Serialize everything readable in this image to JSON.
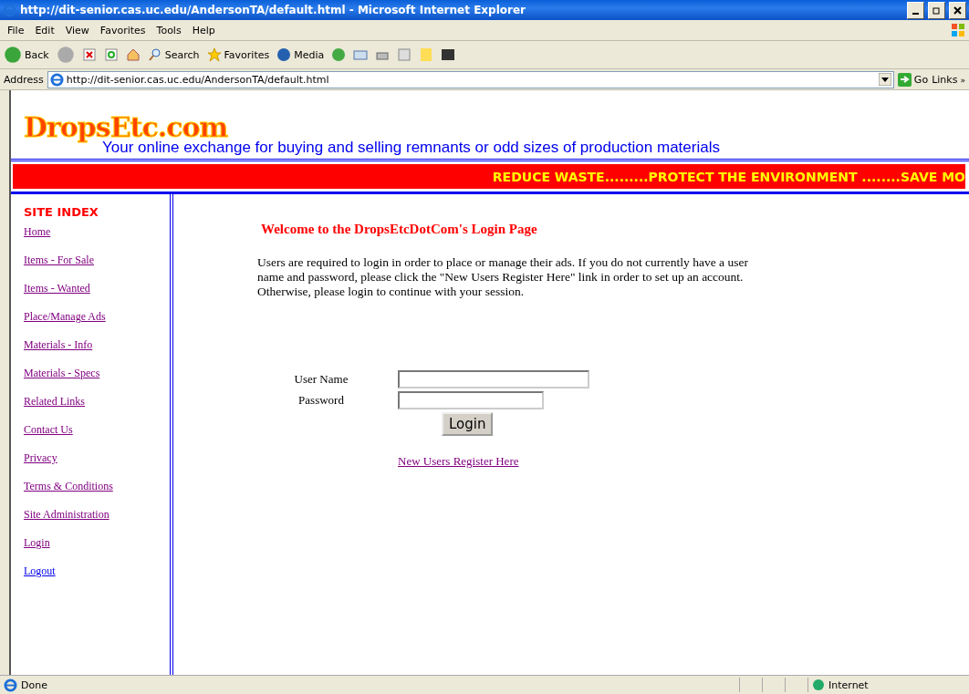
{
  "window": {
    "title": "http://dit-senior.cas.uc.edu/AndersonTA/default.html - Microsoft Internet Explorer"
  },
  "menu": [
    "File",
    "Edit",
    "View",
    "Favorites",
    "Tools",
    "Help"
  ],
  "toolbar": {
    "back": "Back",
    "search": "Search",
    "favorites": "Favorites",
    "media": "Media"
  },
  "address_bar": {
    "label": "Address",
    "value": "http://dit-senior.cas.uc.edu/AndersonTA/default.html",
    "go": "Go",
    "links": "Links",
    "more": "»"
  },
  "site": {
    "logo": "DropsEtc.com",
    "tagline": "Your online exchange for buying and selling remnants or odd sizes of production materials",
    "banner": "REDUCE WASTE.........PROTECT THE ENVIRONMENT ........SAVE MO"
  },
  "sidebar": {
    "title": "SITE INDEX",
    "items": [
      {
        "label": "Home",
        "visited": true
      },
      {
        "label": "Items - For Sale",
        "visited": true
      },
      {
        "label": "Items - Wanted",
        "visited": true
      },
      {
        "label": "Place/Manage Ads",
        "visited": true
      },
      {
        "label": "Materials - Info",
        "visited": true
      },
      {
        "label": "Materials - Specs",
        "visited": true
      },
      {
        "label": "Related Links",
        "visited": true
      },
      {
        "label": "Contact Us",
        "visited": true
      },
      {
        "label": "Privacy",
        "visited": true
      },
      {
        "label": "Terms & Conditions",
        "visited": true
      },
      {
        "label": "Site Administration",
        "visited": true
      },
      {
        "label": "Login",
        "visited": true
      },
      {
        "label": "Logout",
        "visited": false
      }
    ]
  },
  "content": {
    "heading": "Welcome to the DropsEtcDotCom's Login Page",
    "intro": "Users are required to login in order to place or manage their ads. If you do not currently have a user name and password, please click the \"New Users Register Here\" link in order to set up an account. Otherwise, please login to continue with your session.",
    "fields": [
      {
        "label": "User Name",
        "kind": "text"
      },
      {
        "label": "Password",
        "kind": "password"
      }
    ],
    "submit": "Login",
    "register_link": {
      "label": "New Users Register Here",
      "visited": true
    }
  },
  "status_bar": {
    "text": "Done",
    "zone": "Internet"
  }
}
